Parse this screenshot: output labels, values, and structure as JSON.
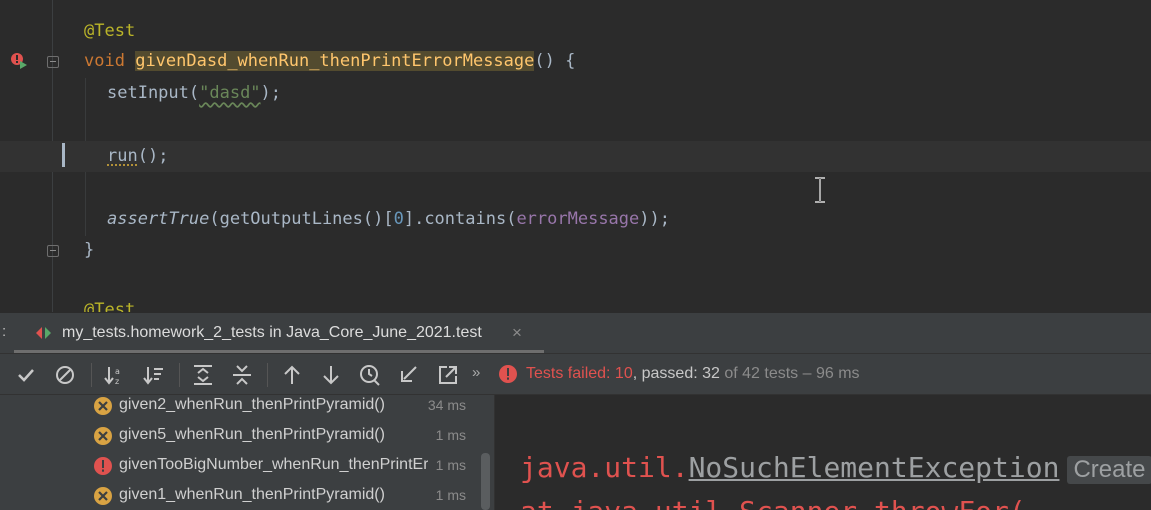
{
  "editor": {
    "lines": {
      "annotation": "@Test",
      "kw_void": "void",
      "method_name": "givenDasd_whenRun_thenPrintErrorMessage",
      "method_tail": "() {",
      "set_input_call": "setInput(",
      "set_input_arg": "\"dasd\"",
      "set_input_tail": ");",
      "run_call": "run",
      "run_tail": "();",
      "assert_fn": "assertTrue",
      "assert_open": "(getOutputLines()[",
      "assert_index": "0",
      "assert_mid": "].contains(",
      "assert_field": "errorMessage",
      "assert_tail": "));",
      "close_brace": "}",
      "next_annotation": "@Test"
    }
  },
  "run_panel": {
    "tab_prefix": ":",
    "tab_label": "my_tests.homework_2_tests in Java_Core_June_2021.test",
    "tab_close": "×",
    "more_label": "»",
    "status": {
      "failed_label": "Tests failed: 10",
      "sep": ", ",
      "passed_label": "passed: 32",
      "tail": " of 42 tests – 96 ms"
    },
    "toolbar_buttons": [
      "check-icon",
      "cancel-icon",
      "sort-alpha-icon",
      "sort-duration-icon",
      "expand-all-icon",
      "collapse-all-icon",
      "arrow-up-icon",
      "arrow-down-icon",
      "history-icon",
      "import-icon",
      "export-icon"
    ],
    "tests": [
      {
        "name": "given2_whenRun_thenPrintPyramid()",
        "time": "34 ms",
        "status": "failed"
      },
      {
        "name": "given5_whenRun_thenPrintPyramid()",
        "time": "1 ms",
        "status": "failed"
      },
      {
        "name": "givenTooBigNumber_whenRun_thenPrintErrorMessage()",
        "time": "1 ms",
        "status": "error"
      },
      {
        "name": "given1_whenRun_thenPrintPyramid()",
        "time": "1 ms",
        "status": "failed"
      }
    ],
    "console": {
      "exception_prefix": "java.util.",
      "exception_name": "NoSuchElementException",
      "create_label": "Create",
      "line2": "  at java.util.Scanner.throwFor("
    }
  },
  "colors": {
    "editor_bg": "#2b2b2b",
    "panel_bg": "#3c3f41",
    "fail": "#e0524f",
    "keyword": "#cc7832",
    "annotation": "#bbb529",
    "string": "#6a8759",
    "method": "#ffc66d"
  }
}
